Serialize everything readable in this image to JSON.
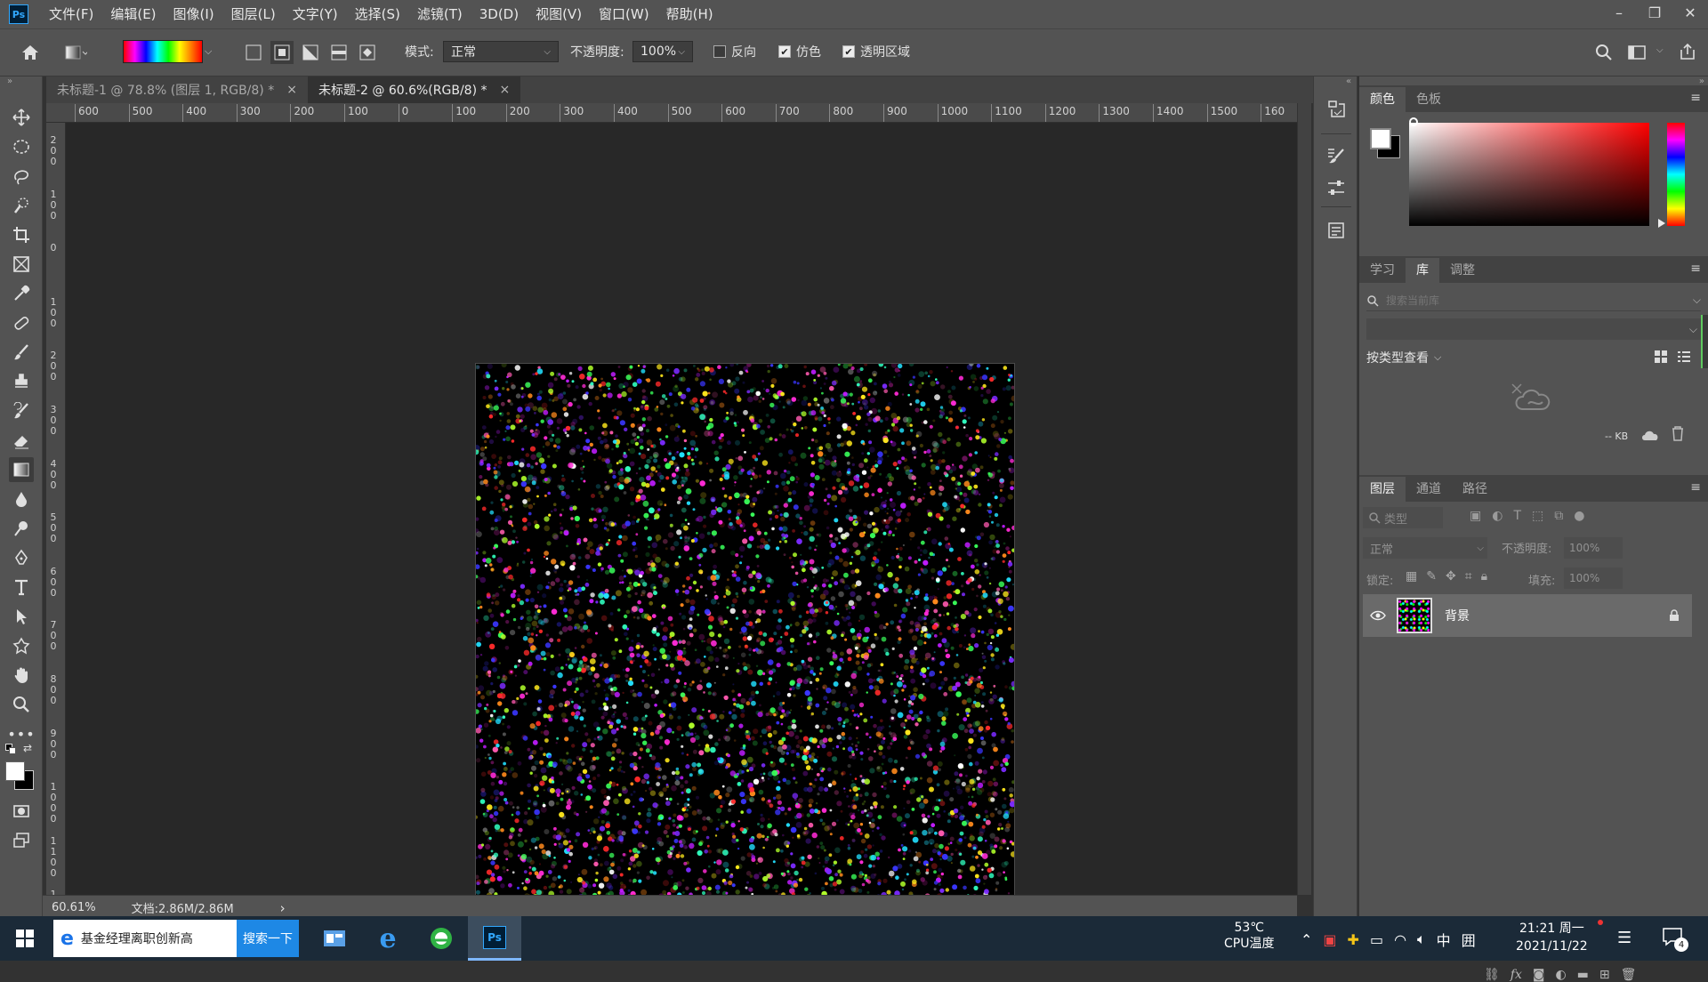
{
  "app": {
    "logo": "Ps",
    "menu": [
      "文件(F)",
      "编辑(E)",
      "图像(I)",
      "图层(L)",
      "文字(Y)",
      "选择(S)",
      "滤镜(T)",
      "3D(D)",
      "视图(V)",
      "窗口(W)",
      "帮助(H)"
    ],
    "window_controls": [
      "–",
      "❐",
      "✕"
    ]
  },
  "options": {
    "mode_label": "模式:",
    "mode_value": "正常",
    "opacity_label": "不透明度:",
    "opacity_value": "100%",
    "reverse_label": "反向",
    "dither_label": "仿色",
    "transparency_label": "透明区域",
    "reverse_checked": false,
    "dither_checked": true,
    "transparency_checked": true
  },
  "tabs": [
    {
      "label": "未标题-1 @ 78.8% (图层 1, RGB/8) *",
      "close": "×"
    },
    {
      "label": "未标题-2 @ 60.6%(RGB/8) *",
      "close": "×"
    }
  ],
  "ruler_top": [
    "600",
    "500",
    "400",
    "300",
    "200",
    "100",
    "0",
    "100",
    "200",
    "300",
    "400",
    "500",
    "600",
    "700",
    "800",
    "900",
    "1000",
    "1100",
    "1200",
    "1300",
    "1400",
    "1500",
    "160"
  ],
  "ruler_left": [
    "200",
    "100",
    "0",
    "100",
    "200",
    "300",
    "400",
    "500",
    "600",
    "700",
    "800",
    "900",
    "1000",
    "1100",
    "1"
  ],
  "status": {
    "zoom": "60.61%",
    "doc": "文档:2.86M/2.86M",
    "arrow": "›"
  },
  "color_panel": {
    "tabs": [
      "颜色",
      "色板"
    ]
  },
  "library_panel": {
    "tabs": [
      "学习",
      "库",
      "调整"
    ],
    "search_placeholder": "搜索当前库",
    "view_by": "按类型查看",
    "size": "-- KB"
  },
  "layers_panel": {
    "tabs": [
      "图层",
      "通道",
      "路径"
    ],
    "filter_placeholder": "类型",
    "blend_mode": "正常",
    "opacity_label": "不透明度:",
    "opacity_value": "100%",
    "lock_label": "锁定:",
    "fill_label": "填充:",
    "fill_value": "100%",
    "layers": [
      {
        "name": "背景",
        "locked": true,
        "visible": true
      }
    ]
  },
  "taskbar": {
    "search_text": "基金经理离职创新高",
    "search_button": "搜索一下",
    "cpu_temp": "53℃",
    "cpu_label": "CPU温度",
    "ime": "中",
    "time": "21:21 周一",
    "date": "2021/11/22",
    "notif_count": "4"
  },
  "colors": {
    "accent": "#31a8ff",
    "panel_bg": "#535353",
    "canvas_bg": "#282828"
  }
}
